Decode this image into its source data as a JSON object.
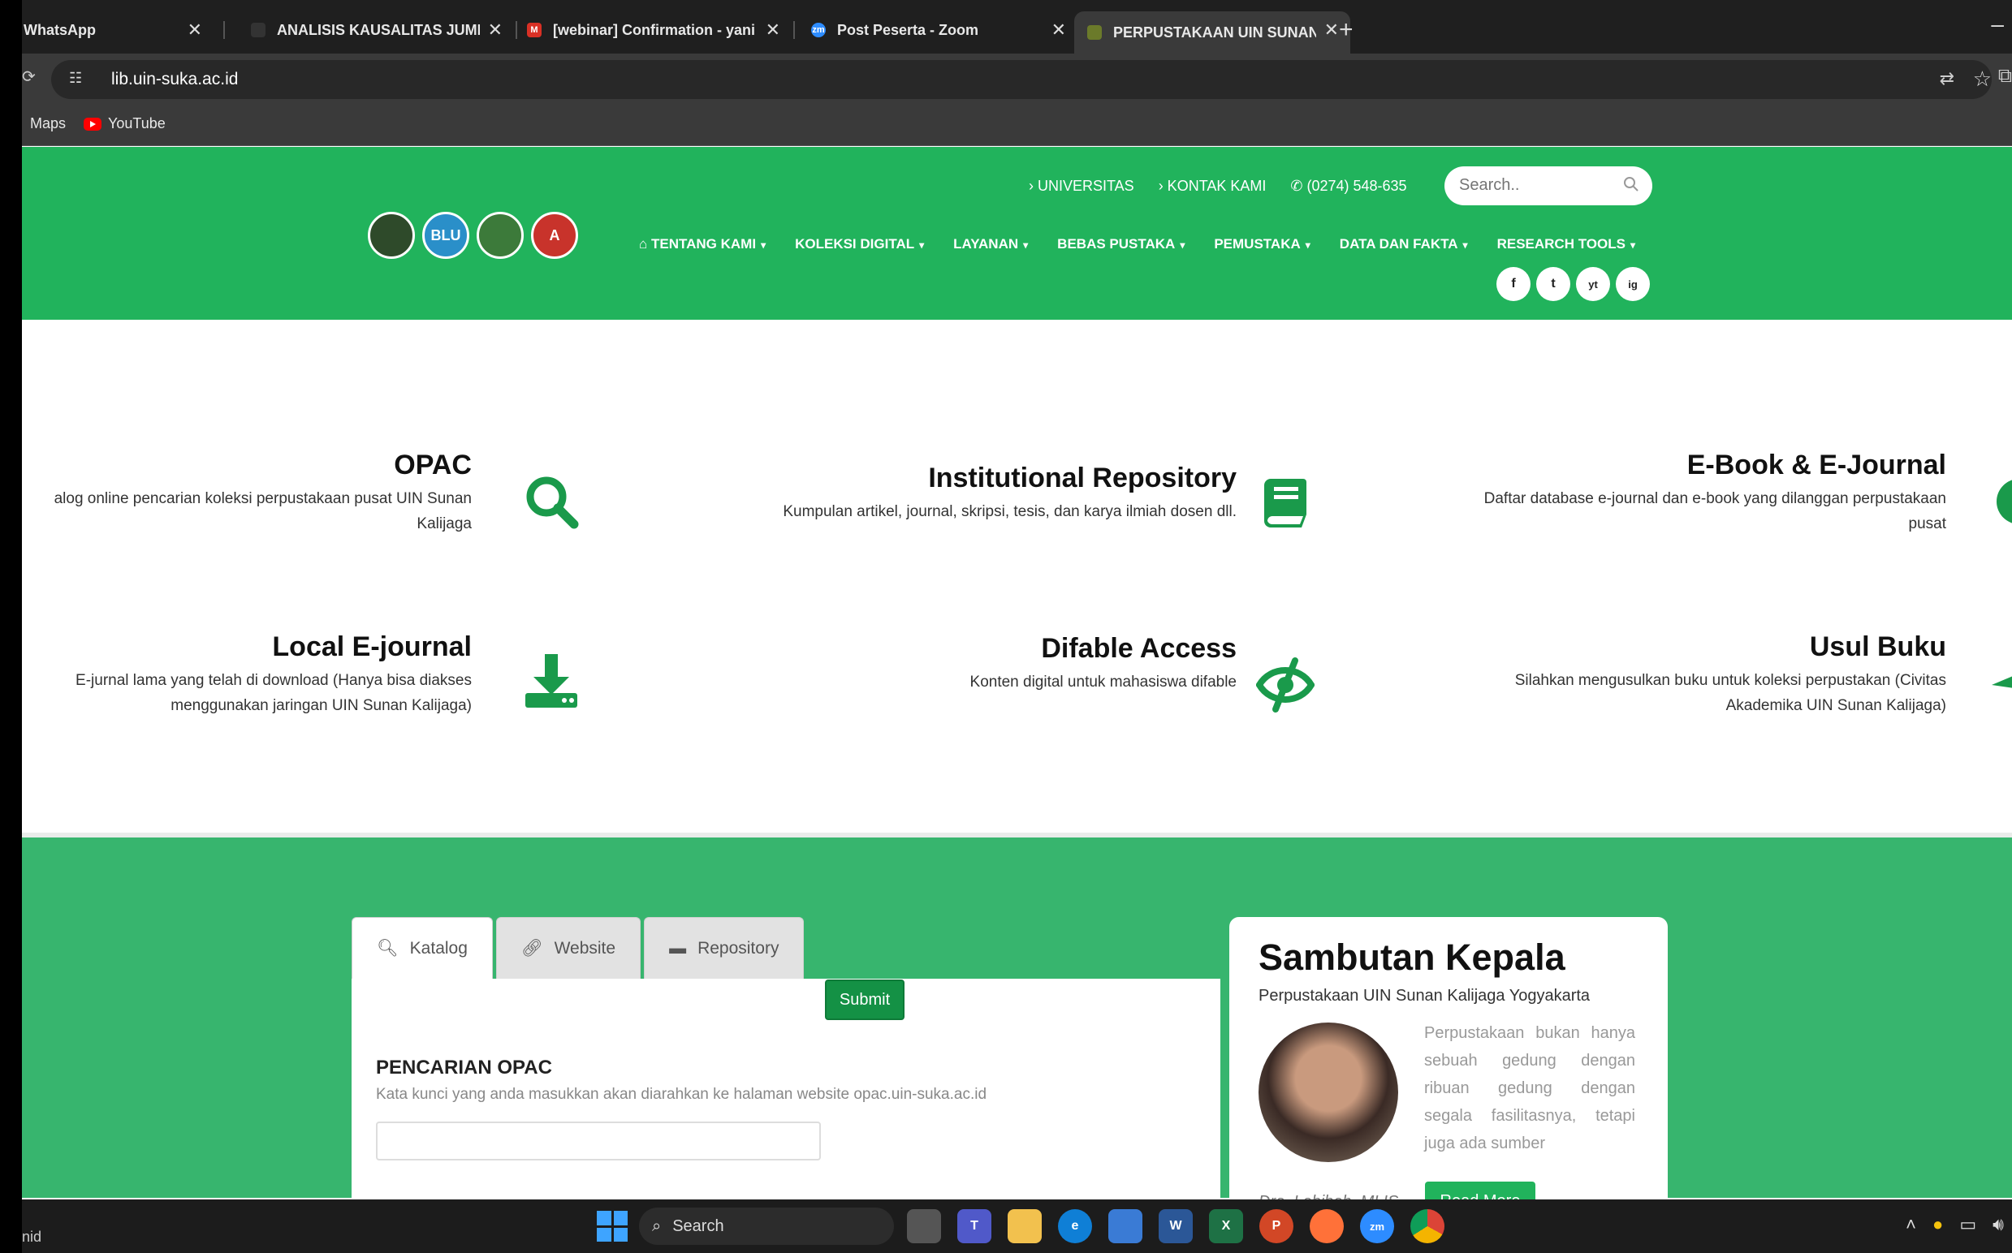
{
  "browser": {
    "tabs": [
      {
        "title": "WhatsApp"
      },
      {
        "title": "ANALISIS KAUSALITAS JUMLA"
      },
      {
        "title": "[webinar] Confirmation - yani"
      },
      {
        "title": "Post Peserta - Zoom"
      },
      {
        "title": "PERPUSTAKAAN UIN SUNAN"
      }
    ],
    "url": "lib.uin-suka.ac.id",
    "bookmarks": [
      "Maps",
      "YouTube"
    ],
    "status_url": "nid"
  },
  "header": {
    "top_links": [
      "› UNIVERSITAS",
      "› KONTAK KAMI",
      "(0274) 548-635"
    ],
    "search_placeholder": "Search..",
    "nav": [
      "TENTANG KAMI",
      "KOLEKSI DIGITAL",
      "LAYANAN",
      "BEBAS PUSTAKA",
      "PEMUSTAKA",
      "DATA DAN FAKTA",
      "RESEARCH TOOLS"
    ],
    "logos": [
      "",
      "BLU",
      "",
      "A"
    ],
    "social": [
      "f",
      "t",
      "yt",
      "ig"
    ]
  },
  "services": [
    {
      "title": "OPAC",
      "desc_1": "alog online pencarian koleksi perpustakaan pusat UIN Sunan",
      "desc_2": "Kalijaga"
    },
    {
      "title": "Institutional Repository",
      "desc_1": "Kumpulan artikel, journal, skripsi, tesis, dan karya ilmiah dosen dll.",
      "desc_2": ""
    },
    {
      "title": "E-Book & E-Journal",
      "desc_1": "Daftar database e-journal dan e-book yang dilanggan perpustakaan",
      "desc_2": "pusat"
    },
    {
      "title": "Local E-journal",
      "desc_1": "E-jurnal lama yang telah di download (Hanya bisa diakses",
      "desc_2": "menggunakan jaringan UIN Sunan Kalijaga)"
    },
    {
      "title": "Difable Access",
      "desc_1": "Konten digital untuk mahasiswa difable",
      "desc_2": ""
    },
    {
      "title": "Usul Buku",
      "desc_1": "Silahkan mengusulkan buku untuk koleksi perpustakan (Civitas",
      "desc_2": "Akademika UIN Sunan Kalijaga)"
    }
  ],
  "search_tabs": [
    "Katalog",
    "Website",
    "Repository"
  ],
  "opac": {
    "heading": "PENCARIAN OPAC",
    "hint": "Kata kunci yang anda masukkan akan diarahkan ke halaman website opac.uin-suka.ac.id",
    "input_value": "",
    "submit_label": "Submit"
  },
  "kepala": {
    "title": "Sambutan Kepala",
    "subtitle": "Perpustakaan UIN Sunan Kalijaga Yogyakarta",
    "text": "Perpustakaan bukan hanya sebuah gedung dengan ribuan gedung dengan segala fasilitasnya, tetapi juga ada sumber",
    "signature": "Dra. Labibah, MLIS",
    "read_more": "Read More"
  },
  "taskbar": {
    "search_label": "Search"
  },
  "colors": {
    "brand_green": "#21b35c",
    "section_green": "#37b56e",
    "icon_green": "#1a9a4b"
  }
}
